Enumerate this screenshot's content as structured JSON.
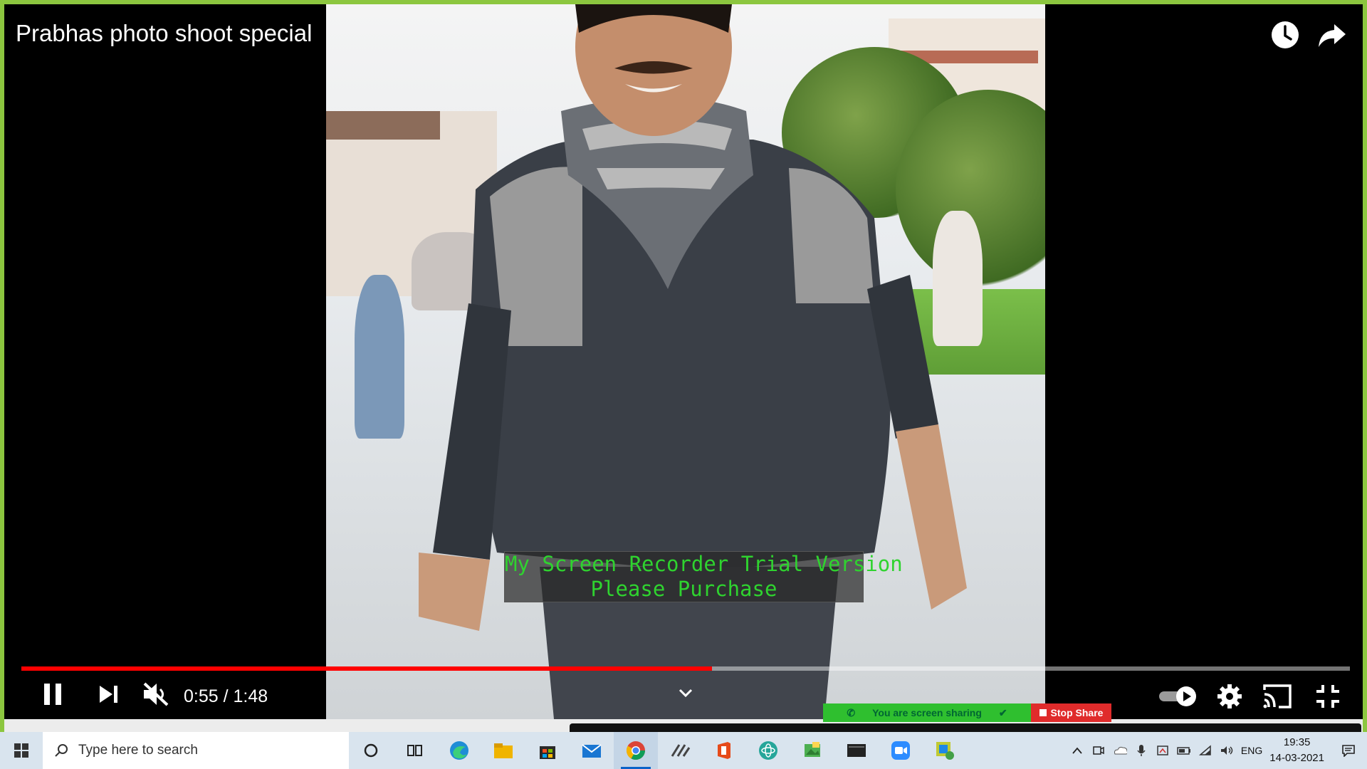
{
  "video": {
    "title": "Prabhas photo shoot special",
    "progress_fraction": 0.52,
    "time": "0:55 / 1:48"
  },
  "watermark": {
    "line1": "My Screen Recorder Trial Version",
    "line2": "Please Purchase"
  },
  "zoom": {
    "sharing_label": "You are screen sharing",
    "stop_label": "Stop Share"
  },
  "taskbar": {
    "search_placeholder": "Type here to search",
    "lang": "ENG",
    "time": "19:35",
    "date": "14-03-2021"
  },
  "icons": [
    "watch-later-icon",
    "share-icon",
    "pause-icon",
    "next-icon",
    "mute-icon",
    "autoplay-toggle",
    "settings-icon",
    "cast-icon",
    "exit-fullscreen-icon",
    "chevron-down-icon"
  ],
  "colors": {
    "accent_border": "#8cc63f",
    "progress": "#ff0000",
    "zoom_green": "#2fbf2f",
    "zoom_red": "#e02b2b",
    "watermark_text": "#2fd32f"
  }
}
